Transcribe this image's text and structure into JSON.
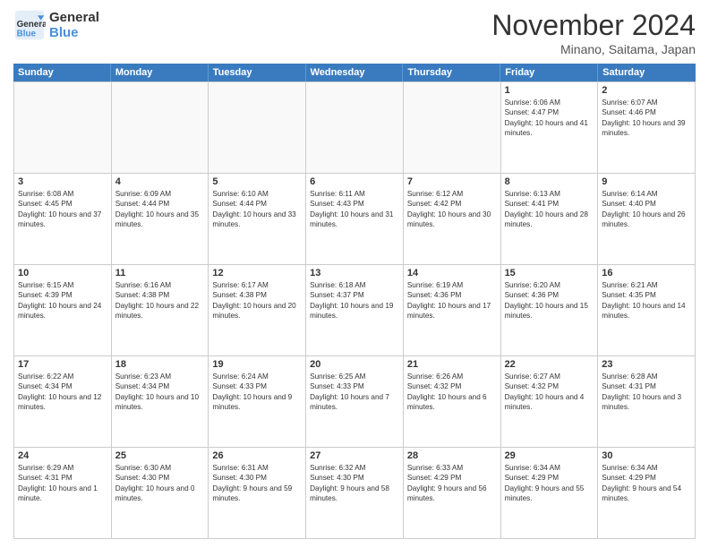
{
  "header": {
    "logo_line1": "General",
    "logo_line2": "Blue",
    "month": "November 2024",
    "location": "Minano, Saitama, Japan"
  },
  "weekdays": [
    "Sunday",
    "Monday",
    "Tuesday",
    "Wednesday",
    "Thursday",
    "Friday",
    "Saturday"
  ],
  "rows": [
    [
      {
        "day": "",
        "info": "",
        "empty": true
      },
      {
        "day": "",
        "info": "",
        "empty": true
      },
      {
        "day": "",
        "info": "",
        "empty": true
      },
      {
        "day": "",
        "info": "",
        "empty": true
      },
      {
        "day": "",
        "info": "",
        "empty": true
      },
      {
        "day": "1",
        "info": "Sunrise: 6:06 AM\nSunset: 4:47 PM\nDaylight: 10 hours and 41 minutes.",
        "empty": false
      },
      {
        "day": "2",
        "info": "Sunrise: 6:07 AM\nSunset: 4:46 PM\nDaylight: 10 hours and 39 minutes.",
        "empty": false
      }
    ],
    [
      {
        "day": "3",
        "info": "Sunrise: 6:08 AM\nSunset: 4:45 PM\nDaylight: 10 hours and 37 minutes.",
        "empty": false
      },
      {
        "day": "4",
        "info": "Sunrise: 6:09 AM\nSunset: 4:44 PM\nDaylight: 10 hours and 35 minutes.",
        "empty": false
      },
      {
        "day": "5",
        "info": "Sunrise: 6:10 AM\nSunset: 4:44 PM\nDaylight: 10 hours and 33 minutes.",
        "empty": false
      },
      {
        "day": "6",
        "info": "Sunrise: 6:11 AM\nSunset: 4:43 PM\nDaylight: 10 hours and 31 minutes.",
        "empty": false
      },
      {
        "day": "7",
        "info": "Sunrise: 6:12 AM\nSunset: 4:42 PM\nDaylight: 10 hours and 30 minutes.",
        "empty": false
      },
      {
        "day": "8",
        "info": "Sunrise: 6:13 AM\nSunset: 4:41 PM\nDaylight: 10 hours and 28 minutes.",
        "empty": false
      },
      {
        "day": "9",
        "info": "Sunrise: 6:14 AM\nSunset: 4:40 PM\nDaylight: 10 hours and 26 minutes.",
        "empty": false
      }
    ],
    [
      {
        "day": "10",
        "info": "Sunrise: 6:15 AM\nSunset: 4:39 PM\nDaylight: 10 hours and 24 minutes.",
        "empty": false
      },
      {
        "day": "11",
        "info": "Sunrise: 6:16 AM\nSunset: 4:38 PM\nDaylight: 10 hours and 22 minutes.",
        "empty": false
      },
      {
        "day": "12",
        "info": "Sunrise: 6:17 AM\nSunset: 4:38 PM\nDaylight: 10 hours and 20 minutes.",
        "empty": false
      },
      {
        "day": "13",
        "info": "Sunrise: 6:18 AM\nSunset: 4:37 PM\nDaylight: 10 hours and 19 minutes.",
        "empty": false
      },
      {
        "day": "14",
        "info": "Sunrise: 6:19 AM\nSunset: 4:36 PM\nDaylight: 10 hours and 17 minutes.",
        "empty": false
      },
      {
        "day": "15",
        "info": "Sunrise: 6:20 AM\nSunset: 4:36 PM\nDaylight: 10 hours and 15 minutes.",
        "empty": false
      },
      {
        "day": "16",
        "info": "Sunrise: 6:21 AM\nSunset: 4:35 PM\nDaylight: 10 hours and 14 minutes.",
        "empty": false
      }
    ],
    [
      {
        "day": "17",
        "info": "Sunrise: 6:22 AM\nSunset: 4:34 PM\nDaylight: 10 hours and 12 minutes.",
        "empty": false
      },
      {
        "day": "18",
        "info": "Sunrise: 6:23 AM\nSunset: 4:34 PM\nDaylight: 10 hours and 10 minutes.",
        "empty": false
      },
      {
        "day": "19",
        "info": "Sunrise: 6:24 AM\nSunset: 4:33 PM\nDaylight: 10 hours and 9 minutes.",
        "empty": false
      },
      {
        "day": "20",
        "info": "Sunrise: 6:25 AM\nSunset: 4:33 PM\nDaylight: 10 hours and 7 minutes.",
        "empty": false
      },
      {
        "day": "21",
        "info": "Sunrise: 6:26 AM\nSunset: 4:32 PM\nDaylight: 10 hours and 6 minutes.",
        "empty": false
      },
      {
        "day": "22",
        "info": "Sunrise: 6:27 AM\nSunset: 4:32 PM\nDaylight: 10 hours and 4 minutes.",
        "empty": false
      },
      {
        "day": "23",
        "info": "Sunrise: 6:28 AM\nSunset: 4:31 PM\nDaylight: 10 hours and 3 minutes.",
        "empty": false
      }
    ],
    [
      {
        "day": "24",
        "info": "Sunrise: 6:29 AM\nSunset: 4:31 PM\nDaylight: 10 hours and 1 minute.",
        "empty": false
      },
      {
        "day": "25",
        "info": "Sunrise: 6:30 AM\nSunset: 4:30 PM\nDaylight: 10 hours and 0 minutes.",
        "empty": false
      },
      {
        "day": "26",
        "info": "Sunrise: 6:31 AM\nSunset: 4:30 PM\nDaylight: 9 hours and 59 minutes.",
        "empty": false
      },
      {
        "day": "27",
        "info": "Sunrise: 6:32 AM\nSunset: 4:30 PM\nDaylight: 9 hours and 58 minutes.",
        "empty": false
      },
      {
        "day": "28",
        "info": "Sunrise: 6:33 AM\nSunset: 4:29 PM\nDaylight: 9 hours and 56 minutes.",
        "empty": false
      },
      {
        "day": "29",
        "info": "Sunrise: 6:34 AM\nSunset: 4:29 PM\nDaylight: 9 hours and 55 minutes.",
        "empty": false
      },
      {
        "day": "30",
        "info": "Sunrise: 6:34 AM\nSunset: 4:29 PM\nDaylight: 9 hours and 54 minutes.",
        "empty": false
      }
    ]
  ]
}
